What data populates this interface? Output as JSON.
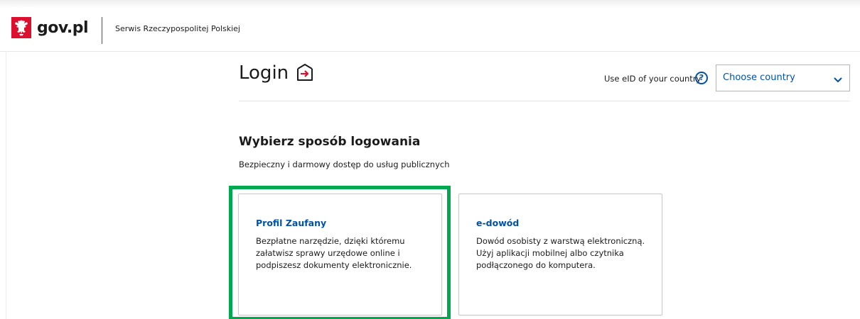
{
  "header": {
    "logo_text": "gov.pl",
    "service_name": "Serwis Rzeczypospolitej Polskiej"
  },
  "login": {
    "title": "Login"
  },
  "eid": {
    "label": "Use eID of your country",
    "help_glyph": "?",
    "country_select_value": "Choose country"
  },
  "section": {
    "title": "Wybierz sposób logowania",
    "subtitle": "Bezpieczny i darmowy dostęp do usług publicznych"
  },
  "cards": [
    {
      "title": "Profil Zaufany",
      "description": "Bezpłatne narzędzie, dzięki któremu załatwisz sprawy urzędowe online i podpiszesz dokumenty elektronicznie.",
      "highlighted": true
    },
    {
      "title": "e-dowód",
      "description": "Dowód osobisty z warstwą elektroniczną. Użyj aplikacji mobilnej albo czytnika podłączonego do komputera.",
      "highlighted": false
    }
  ],
  "colors": {
    "brand_red": "#dc0f2e",
    "link_blue": "#0052a5",
    "highlight_green": "#00a84f"
  },
  "icons": {
    "logo": "polish-eagle-emblem",
    "login": "login-arrow-icon",
    "help": "question-circle-icon",
    "dropdown": "chevron-down-icon"
  }
}
